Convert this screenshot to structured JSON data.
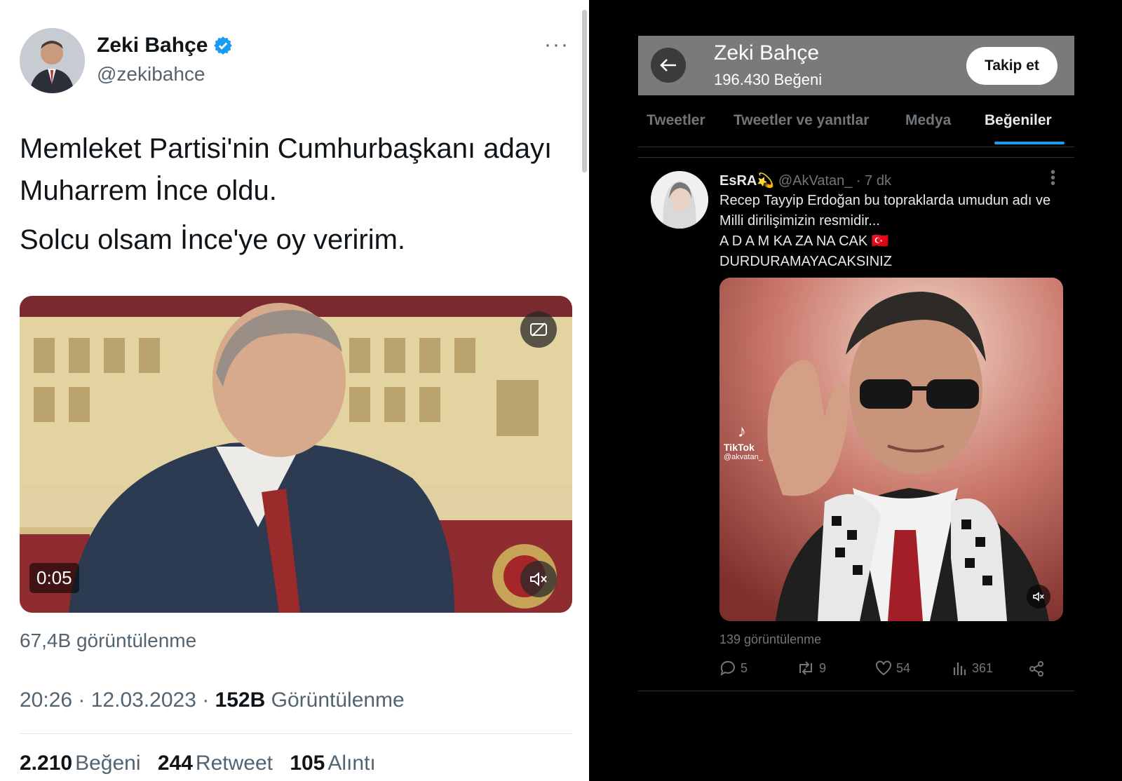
{
  "left_tweet": {
    "author_name": "Zeki Bahçe",
    "author_handle": "@zekibahce",
    "more_label": "···",
    "text_line1": "Memleket Partisi'nin Cumhurbaşkanı adayı Muharrem İnce oldu.",
    "text_line2": "Solcu olsam İnce'ye oy veririm.",
    "video_time": "0:05",
    "video_views": "67,4B görüntülenme",
    "timestamp": "20:26 · 12.03.2023 ·",
    "total_views_count": "152B",
    "total_views_label": "Görüntülenme",
    "likes_count": "2.210",
    "likes_label": "Beğeni",
    "retweets_count": "244",
    "retweets_label": "Retweet",
    "quotes_count": "105",
    "quotes_label": "Alıntı"
  },
  "right_panel": {
    "header": {
      "title": "Zeki Bahçe",
      "subtitle": "196.430 Beğeni",
      "follow_label": "Takip et"
    },
    "tabs": [
      "Tweetler",
      "Tweetler ve yanıtlar",
      "Medya",
      "Beğeniler"
    ],
    "active_tab": "Beğeniler",
    "tweet": {
      "display_name": "EsRA💫",
      "handle_time": "@AkVatan_ · 7 dk",
      "text_line1": "Recep Tayyip Erdoğan bu topraklarda umudun adı ve Milli dirilişimizin resmidir...",
      "text_line2": "A D A M KA ZA NA CAK 🇹🇷",
      "text_line3": "DURDURAMAYACAKSINIZ",
      "watermark_app": "TikTok",
      "watermark_handle": "@akvatan_",
      "views": "139 görüntülenme",
      "replies": "5",
      "retweets": "9",
      "likes": "54",
      "analytics": "361"
    }
  },
  "colors": {
    "accent": "#1d9bf0",
    "light_bg": "#ffffff",
    "dark_bg": "#000000"
  }
}
